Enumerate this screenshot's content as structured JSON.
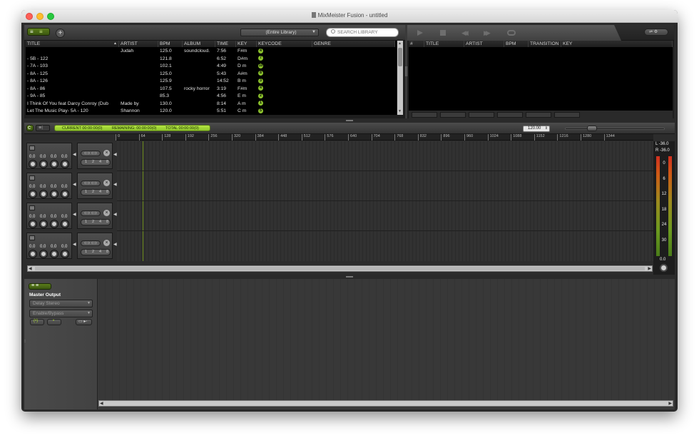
{
  "window": {
    "title": "MixMeister Fusion - untitled"
  },
  "library": {
    "source": "(Entire Library)",
    "search_placeholder": "SEARCH LIBRARY",
    "columns": [
      "TITLE",
      "ARTIST",
      "BPM",
      "ALBUM",
      "TIME",
      "KEY",
      "KEYCODE",
      "GENRE"
    ],
    "rows": [
      {
        "title": "",
        "artist": "Judah",
        "bpm": "125.0",
        "album": "soundcloud.",
        "time": "7:56",
        "key": "F#m",
        "keycode": "4"
      },
      {
        "title": "- 5B - 122",
        "artist": "",
        "bpm": "121.8",
        "album": "",
        "time": "6:52",
        "key": "D#m",
        "keycode": "7"
      },
      {
        "title": "- 7A - 103",
        "artist": "",
        "bpm": "102.1",
        "album": "",
        "time": "4:49",
        "key": "D m",
        "keycode": "10"
      },
      {
        "title": "- 8A - 125",
        "artist": "",
        "bpm": "125.0",
        "album": "",
        "time": "5:43",
        "key": "A#m",
        "keycode": "8"
      },
      {
        "title": "- 8A - 126",
        "artist": "",
        "bpm": "125.9",
        "album": "",
        "time": "14:52",
        "key": "B m",
        "keycode": "3"
      },
      {
        "title": "- 8A - 86",
        "artist": "",
        "bpm": "107.5",
        "album": "rocky horror",
        "time": "3:19",
        "key": "F#m",
        "keycode": "4"
      },
      {
        "title": "- 9A - 85",
        "artist": "",
        "bpm": "85.3",
        "album": "",
        "time": "4:56",
        "key": "E m",
        "keycode": "2"
      },
      {
        "title": "I Think Of You feat Darcy Conroy (Dub",
        "artist": "Made by",
        "bpm": "130.0",
        "album": "",
        "time": "8:14",
        "key": "A m",
        "keycode": "1"
      },
      {
        "title": "Let The Music Play- 5A - 120",
        "artist": "Shannon",
        "bpm": "120.0",
        "album": "",
        "time": "5:51",
        "key": "C m",
        "keycode": "5"
      }
    ]
  },
  "playlist": {
    "columns": [
      "#",
      "TITLE",
      "ARTIST",
      "BPM",
      "TRANSITION",
      "KEY"
    ]
  },
  "timeline": {
    "current": "CURRENT 00:00:00(0)",
    "remaining": "REMAINING: 00:00:00(0)",
    "total": "TOTAL 00:00:00(0)",
    "bpm": "120.00",
    "ruler": [
      "0",
      "64",
      "128",
      "192",
      "256",
      "320",
      "384",
      "448",
      "512",
      "576",
      "640",
      "704",
      "768",
      "832",
      "896",
      "960",
      "1024",
      "1088",
      "1152",
      "1216",
      "1280",
      "1344"
    ],
    "track_values": [
      "0.0",
      "0.0",
      "0.0",
      "0.0"
    ],
    "track_bars": [
      "1",
      "2",
      "4",
      "8"
    ]
  },
  "meter": {
    "left": "L -36.0",
    "right": "R -36.0",
    "ticks": [
      "0",
      "6",
      "12",
      "18",
      "24",
      "30"
    ],
    "value": "0.0"
  },
  "effects": {
    "title": "Master Output",
    "effect": "Delay Stereo",
    "mode": "Enable/Bypass"
  },
  "colors": {
    "accent": "#a5d62e",
    "background": "#2a2a2a"
  }
}
